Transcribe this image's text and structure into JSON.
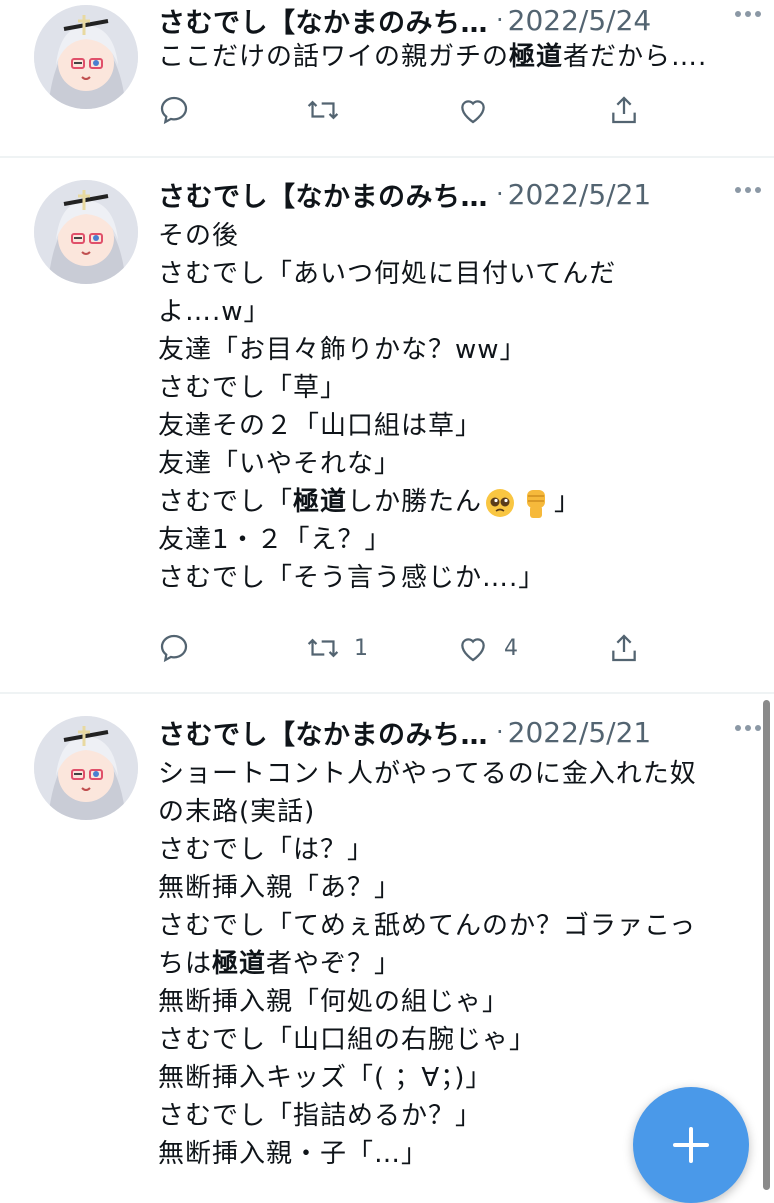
{
  "tweets": [
    {
      "author": "さむでし【なかまのみち…",
      "separator": "·",
      "date": "2022/5/24",
      "lines": [
        {
          "segments": [
            "ここだけの話ワイの親ガチの",
            "極道",
            "者だから…."
          ]
        }
      ],
      "reply_count": "",
      "retweet_count": "",
      "like_count": ""
    },
    {
      "author": "さむでし【なかまのみち…",
      "separator": "·",
      "date": "2022/5/21",
      "lines": [
        "その後",
        "さむでし「あいつ何処に目付いてんだ",
        "よ….w」",
        "友達「お目々飾りかな？ww」",
        "さむでし「草」",
        "友達その２「山口組は草」",
        "友達「いやそれな」",
        {
          "pre": "さむでし「",
          "bold": "極道",
          "post": "しか勝たん",
          "emoji": [
            "pleading-face",
            "raised-fist"
          ],
          "end": "」"
        },
        "友達1・２「え？」",
        "さむでし「そう言う感じか….」"
      ],
      "reply_count": "",
      "retweet_count": "1",
      "like_count": "4"
    },
    {
      "author": "さむでし【なかまのみち…",
      "separator": "·",
      "date": "2022/5/21",
      "lines": [
        "ショートコント人がやってるのに金入れた奴",
        "の末路(実話)",
        "さむでし「は？」",
        "無断挿入親「あ？」",
        "さむでし「てめぇ舐めてんのか？ゴラァこっ",
        {
          "pre": "ちは",
          "bold": "極道",
          "post": "者やぞ？」"
        },
        "無断挿入親「何処の組じゃ」",
        "さむでし「山口組の右腕じゃ」",
        "無断挿入キッズ「(  ；∀；)」",
        "さむでし「指詰めるか？」",
        "無断挿入親・子「…」"
      ]
    }
  ],
  "icons": {
    "reply": "reply-icon",
    "retweet": "retweet-icon",
    "like": "heart-icon",
    "share": "share-icon",
    "more": "more-dots-icon",
    "compose": "compose-plus-icon"
  },
  "colors": {
    "accent": "#4a99e9",
    "secondary_text": "#536471",
    "divider": "#eff3f4"
  }
}
